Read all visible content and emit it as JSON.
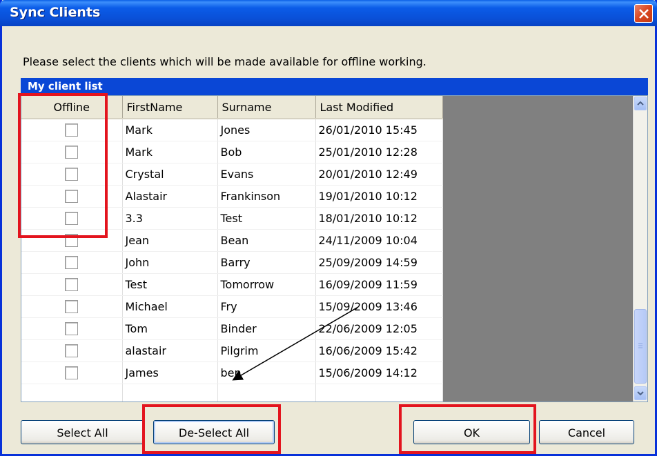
{
  "window": {
    "title": "Sync Clients"
  },
  "instructions": "Please select the clients which will be made available for offline working.",
  "list_title": "My client list",
  "columns": [
    "Offline",
    "FirstName",
    "Surname",
    "Last Modified"
  ],
  "rows": [
    {
      "first": "Mark",
      "surname": "Jones",
      "modified": "26/01/2010 15:45"
    },
    {
      "first": "Mark",
      "surname": "Bob",
      "modified": "25/01/2010 12:28"
    },
    {
      "first": "Crystal",
      "surname": "Evans",
      "modified": "20/01/2010 12:49"
    },
    {
      "first": "Alastair",
      "surname": "Frankinson",
      "modified": "19/01/2010 10:12"
    },
    {
      "first": "3.3",
      "surname": "Test",
      "modified": "18/01/2010 10:12"
    },
    {
      "first": "Jean",
      "surname": "Bean",
      "modified": "24/11/2009 10:04"
    },
    {
      "first": "John",
      "surname": "Barry",
      "modified": "25/09/2009 14:59"
    },
    {
      "first": "Test",
      "surname": "Tomorrow",
      "modified": "16/09/2009 11:59"
    },
    {
      "first": "Michael",
      "surname": "Fry",
      "modified": "15/09/2009 13:46"
    },
    {
      "first": "Tom",
      "surname": "Binder",
      "modified": "22/06/2009 12:05"
    },
    {
      "first": "alastair",
      "surname": "Pilgrim",
      "modified": "16/06/2009 15:42"
    },
    {
      "first": "James",
      "surname": "ben",
      "modified": "15/06/2009 14:12"
    }
  ],
  "buttons": {
    "select_all": "Select All",
    "deselect_all": "De-Select All",
    "ok": "OK",
    "cancel": "Cancel"
  },
  "colors": {
    "title_bar": "#0A5FE6",
    "list_bar": "#0A47D6",
    "highlight": "#E3141E"
  }
}
